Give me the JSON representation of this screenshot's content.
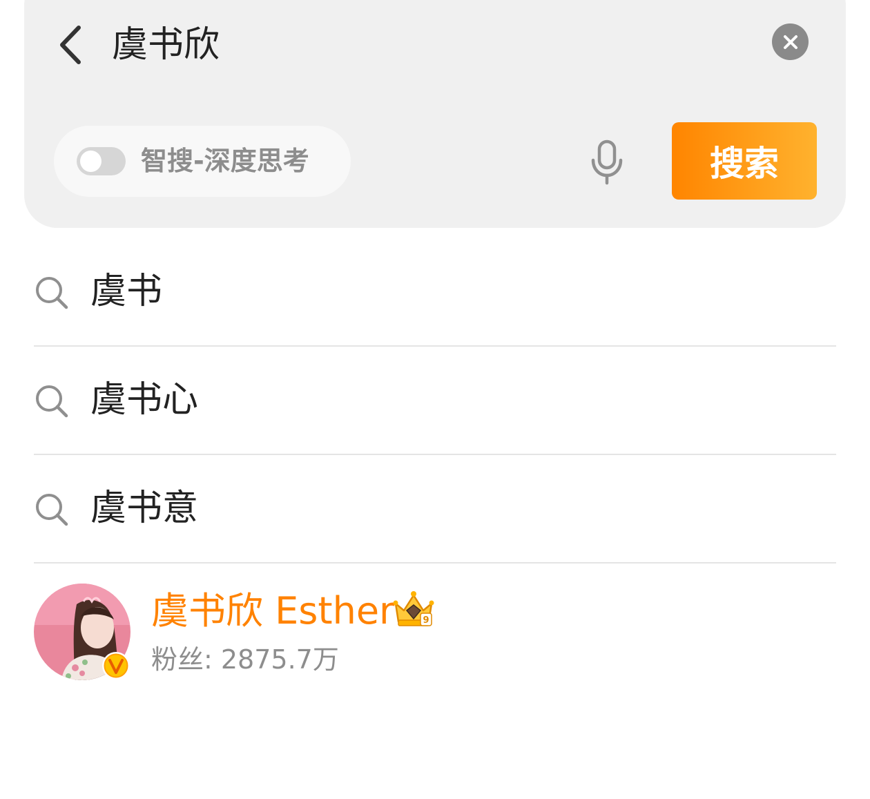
{
  "search": {
    "query": "虞书欣",
    "deep_think_label": "智搜-深度思考",
    "deep_think_enabled": false,
    "submit_label": "搜索"
  },
  "suggestions": [
    {
      "label": "虞书"
    },
    {
      "label": "虞书心"
    },
    {
      "label": "虞书意"
    }
  ],
  "user_result": {
    "name": "虞书欣 Esther",
    "fans": "粉丝: 2875.7万",
    "crown_level": "9"
  },
  "colors": {
    "accent": "#ff8200",
    "button_start": "#ff8500",
    "button_end": "#ffb22e",
    "panel_bg": "#f0f0f0"
  },
  "icons": {
    "back": "chevron-left-icon",
    "clear": "close-icon",
    "mic": "microphone-icon",
    "suggestion": "search-icon",
    "verified": "verified-v-icon",
    "crown": "crown-badge-icon"
  }
}
